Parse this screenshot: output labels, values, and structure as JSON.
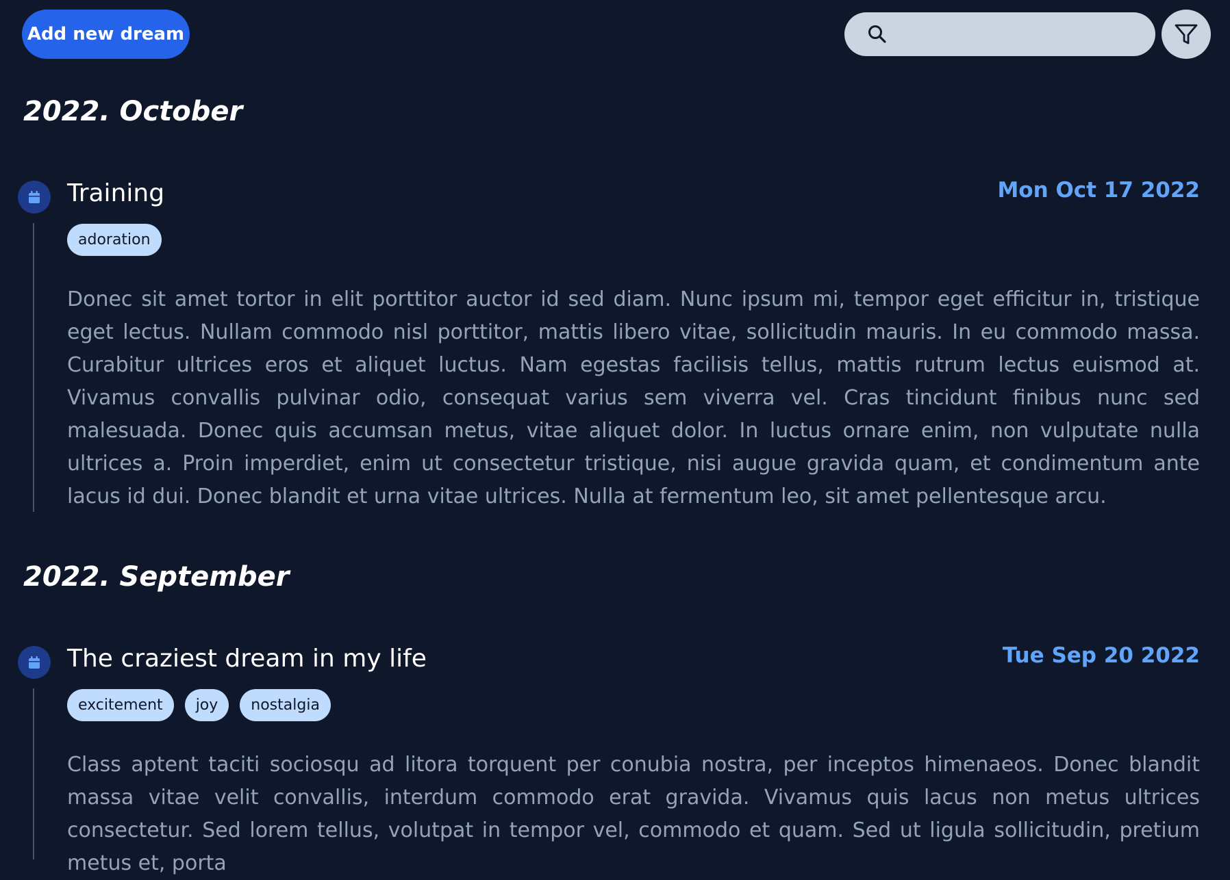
{
  "toolbar": {
    "add_label": "Add new dream",
    "search_placeholder": "",
    "search_value": ""
  },
  "months": [
    {
      "label": "2022. October",
      "entries": [
        {
          "title": "Training",
          "date": "Mon Oct 17 2022",
          "tags": [
            "adoration"
          ],
          "body": "Donec sit amet tortor in elit porttitor auctor id sed diam. Nunc ipsum mi, tempor eget efficitur in, tristique eget lectus. Nullam commodo nisl porttitor, mattis libero vitae, sollicitudin mauris. In eu commodo massa. Curabitur ultrices eros et aliquet luctus. Nam egestas facilisis tellus, mattis rutrum lectus euismod at. Vivamus convallis pulvinar odio, consequat varius sem viverra vel. Cras tincidunt finibus nunc sed malesuada. Donec quis accumsan metus, vitae aliquet dolor. In luctus ornare enim, non vulputate nulla ultrices a. Proin imperdiet, enim ut consectetur tristique, nisi augue gravida quam, et condimentum ante lacus id dui. Donec blandit et urna vitae ultrices. Nulla at fermentum leo, sit amet pellentesque arcu."
        }
      ]
    },
    {
      "label": "2022. September",
      "entries": [
        {
          "title": "The craziest dream in my life",
          "date": "Tue Sep 20 2022",
          "tags": [
            "excitement",
            "joy",
            "nostalgia"
          ],
          "body": "Class aptent taciti sociosqu ad litora torquent per conubia nostra, per inceptos himenaeos. Donec blandit massa vitae velit convallis, interdum commodo erat gravida. Vivamus quis lacus non metus ultrices consectetur. Sed lorem tellus, volutpat in tempor vel, commodo et quam. Sed ut ligula sollicitudin, pretium metus et, porta"
        }
      ]
    }
  ],
  "colors": {
    "background": "#0f172a",
    "accent": "#2563eb",
    "date": "#60a5fa",
    "tag": "#bfdbfe"
  },
  "icons": [
    "search-icon",
    "filter-icon",
    "calendar-icon"
  ]
}
